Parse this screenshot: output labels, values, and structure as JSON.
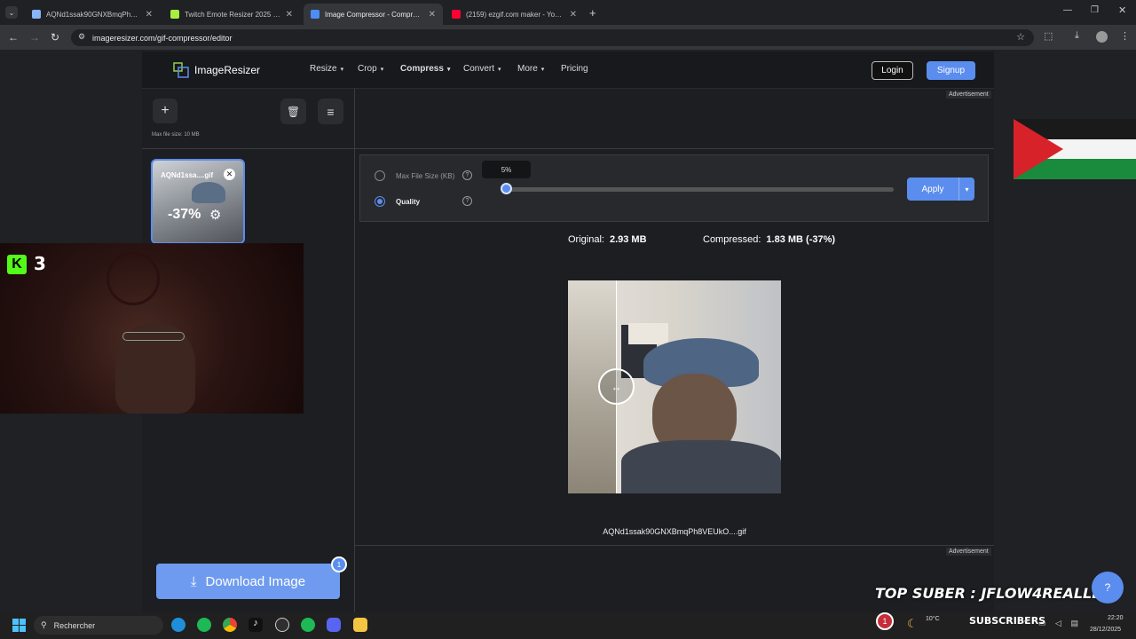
{
  "browser": {
    "tabs": [
      {
        "title": "AQNd1ssak90GNXBmqPh8VEU",
        "color": "#8ab4f8"
      },
      {
        "title": "Twitch Emote Resizer 2025 - Fre",
        "color": "#a7f040"
      },
      {
        "title": "Image Compressor - Compress",
        "color": "#4c8df6"
      },
      {
        "title": "(2159) ezgif.com maker - YouTu",
        "color": "#ff0033"
      }
    ],
    "url": "imageresizer.com/gif-compressor/editor"
  },
  "site": {
    "logo": "ImageResizer",
    "nav": [
      {
        "label": "Resize",
        "chevron": true
      },
      {
        "label": "Crop",
        "chevron": true
      },
      {
        "label": "Compress",
        "chevron": true
      },
      {
        "label": "Convert",
        "chevron": true
      },
      {
        "label": "More",
        "chevron": true
      },
      {
        "label": "Pricing",
        "chevron": false
      }
    ],
    "login": "Login",
    "signup": "Signup",
    "ad_label": "Advertisement",
    "accent": "#5b8def"
  },
  "panel": {
    "max_file_size": "Max file size: 10 MB",
    "thumb_name": "AQNd1ssa....gif",
    "thumb_percent": "-37%",
    "download": "Download Image",
    "download_count": "1"
  },
  "compress": {
    "opt_max": "Max File Size (KB)",
    "opt_quality": "Quality",
    "selected": "quality",
    "slider_tooltip": "5%",
    "slider_value": 0.05,
    "apply": "Apply",
    "original_label": "Original:",
    "original_value": "2.93 MB",
    "compressed_label": "Compressed:",
    "compressed_value": "1.83 MB (-37%)",
    "filename": "AQNd1ssak90GNXBmqPh8VEUkO....gif"
  },
  "overlay": {
    "kick_count": "3",
    "top_suber": "TOP SUBER : JFLOW4REALLL",
    "subscribers": "SUBSCRIBERS",
    "notif_count": "1"
  },
  "taskbar": {
    "search": "Rechercher",
    "weather": "10°C",
    "time": "22:20",
    "date": "28/12/2025"
  }
}
